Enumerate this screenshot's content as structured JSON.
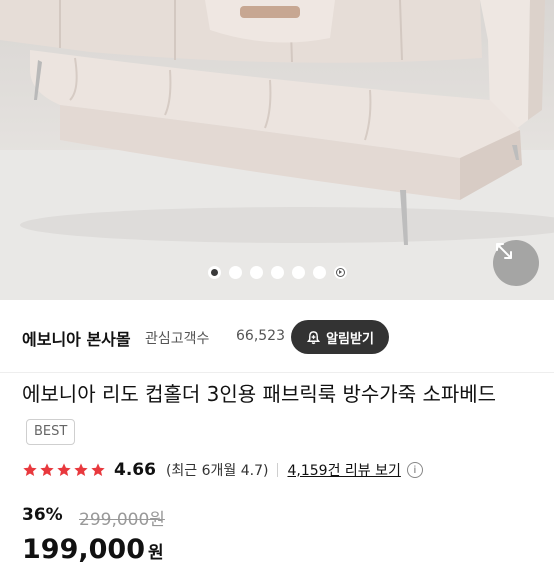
{
  "gallery": {
    "image_alt": "sofa-bed-photo",
    "slide_count": 7,
    "active_slide": 1,
    "expand_icon": "expand-arrows-icon",
    "play_icon": "play-icon"
  },
  "store": {
    "name": "에보니아 본사몰",
    "follow_label": "관심고객수",
    "follow_count": "66,523",
    "alarm_button": "알림받기",
    "alarm_icon": "bell-plus-icon"
  },
  "product": {
    "title": "에보니아 리도 컵홀더 3인용 패브릭룩 방수가죽 소파베드",
    "badge": "BEST"
  },
  "rating": {
    "stars": 5,
    "value": "4.66",
    "recent": "(최근 6개월 4.7)",
    "review_link": "4,159건 리뷰 보기",
    "info_icon": "i"
  },
  "price": {
    "discount": "36%",
    "original": "299,000원",
    "current": "199,000",
    "currency": "원"
  },
  "colors": {
    "star": "#e8383d",
    "alarm_button_bg": "#333333",
    "sofa": "#e9e1dc"
  }
}
